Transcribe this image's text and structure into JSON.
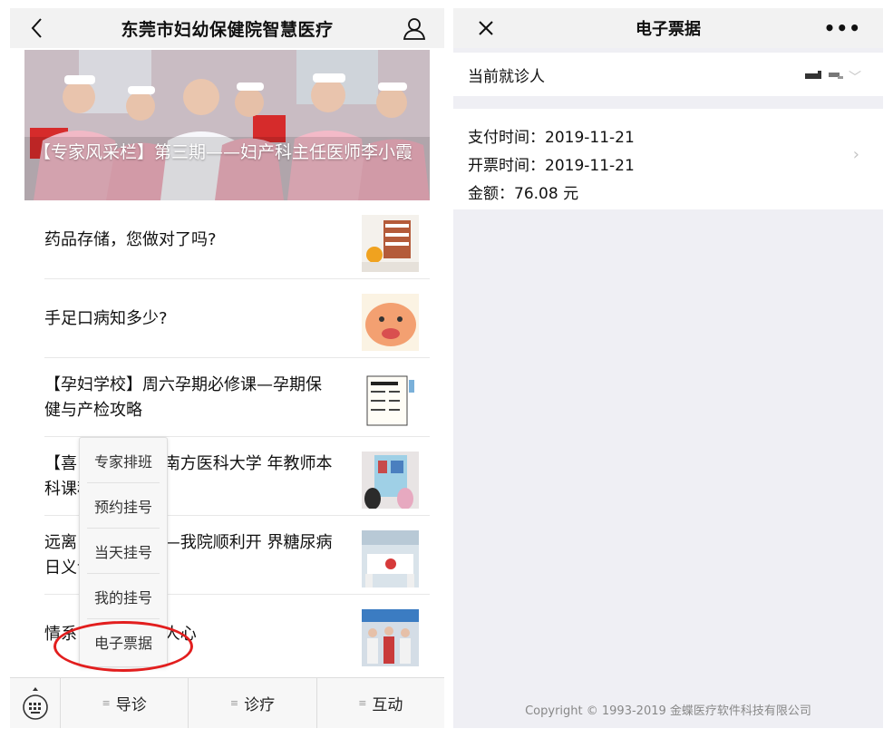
{
  "left": {
    "title": "东莞市妇幼保健院智慧医疗",
    "hero_caption": "【专家风采栏】第三期——妇产科主任医师李小霞",
    "articles": [
      {
        "title": "药品存储，您做对了吗?"
      },
      {
        "title": "手足口病知多少?"
      },
      {
        "title": "【孕妇学校】周六孕期必修课—孕期保健与产检攻略"
      },
      {
        "title": "【喜        莉医师荣获南方医科大学        年教师本科课程教学..."
      },
      {
        "title": "远离        做糖妈妈——我院顺利开        界糖尿病日义诊活动"
      },
      {
        "title": "情系        爱心帮扶暖人心"
      }
    ],
    "popup_menu": [
      "专家排班",
      "预约挂号",
      "当天挂号",
      "我的挂号",
      "电子票据"
    ],
    "tabs": [
      "导诊",
      "诊疗",
      "互动"
    ],
    "tab_menu_glyph": "≡"
  },
  "right": {
    "title": "电子票据",
    "more": "•••",
    "patient_label": "当前就诊人",
    "pay_time": "支付时间：2019-11-21",
    "issue_time": "开票时间：2019-11-21",
    "amount": "金额：76.08 元",
    "copyright": "Copyright © 1993-2019 金蝶医疗软件科技有限公司"
  },
  "colors": {
    "nav_bg": "#f2f2f2",
    "page_bg": "#efeff4",
    "highlight_ring": "#e21e1e",
    "divider": "#e8e8e8"
  },
  "icons": [
    "back-chevron-icon",
    "user-icon",
    "close-icon",
    "more-icon",
    "chevron-down-icon",
    "chevron-right-icon",
    "keyboard-icon",
    "menu-lines-icon"
  ]
}
